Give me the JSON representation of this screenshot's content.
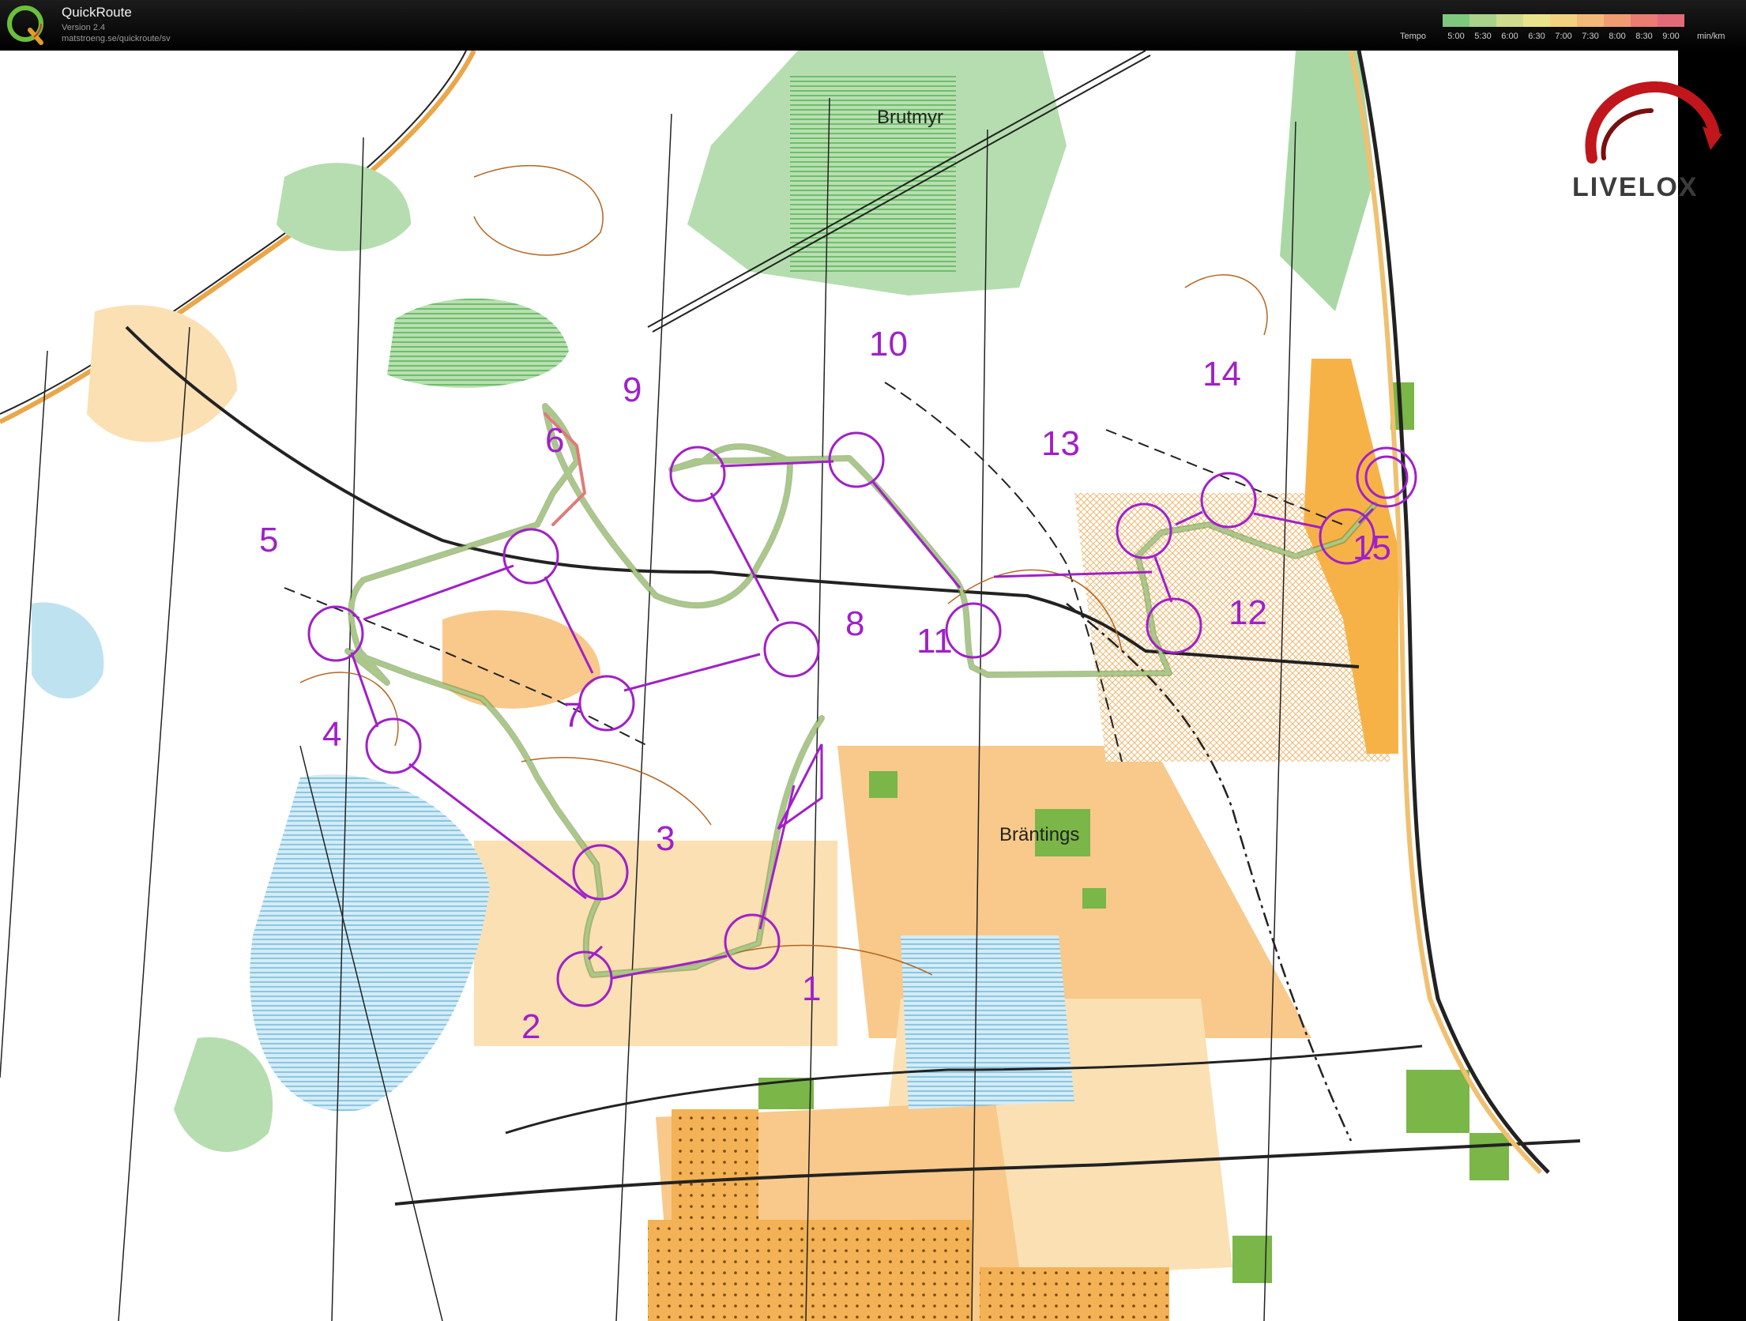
{
  "header": {
    "app_title": "QuickRoute",
    "version": "Version 2.4",
    "url": "matstroeng.se/quickroute/sv",
    "logo_letter": "Q",
    "legend_label": "Tempo",
    "legend_ticks": [
      "5:00",
      "5:30",
      "6:00",
      "6:30",
      "7:00",
      "7:30",
      "8:00",
      "8:30",
      "9:00"
    ],
    "legend_unit": "min/km",
    "legend_colors": [
      "#7fc97f",
      "#a9d38a",
      "#cfdc8e",
      "#e9e38c",
      "#f3d27f",
      "#f3b978",
      "#f09c73",
      "#ea7c72",
      "#e36a78"
    ]
  },
  "branding": {
    "logo_text": "LIVELOX",
    "logo_color": "#c0161c"
  },
  "map": {
    "place_names": [
      {
        "name": "Brutmyr"
      },
      {
        "name": "Bräntings"
      }
    ],
    "course_color": "#a020c8",
    "route_color": "#8aa860",
    "controls": [
      {
        "number": "1"
      },
      {
        "number": "2"
      },
      {
        "number": "3"
      },
      {
        "number": "4"
      },
      {
        "number": "5"
      },
      {
        "number": "6"
      },
      {
        "number": "7"
      },
      {
        "number": "8"
      },
      {
        "number": "9"
      },
      {
        "number": "10"
      },
      {
        "number": "11"
      },
      {
        "number": "12"
      },
      {
        "number": "13"
      },
      {
        "number": "14"
      },
      {
        "number": "15"
      }
    ],
    "colors": {
      "open_land": "#f8c98a",
      "rough_open": "#fbe0b4",
      "forest_green": "#9fd09a",
      "marsh_blue": "#7fc4e8",
      "plantation_green": "#7ab648",
      "road": "#222222",
      "contour": "#b5651d"
    }
  }
}
